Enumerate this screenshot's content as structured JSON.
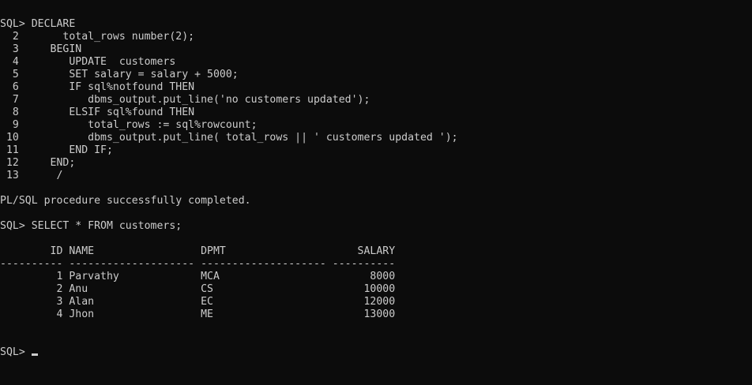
{
  "terminal": {
    "lines": [
      "SQL> DECLARE",
      "  2       total_rows number(2);",
      "  3     BEGIN",
      "  4        UPDATE  customers",
      "  5        SET salary = salary + 5000;",
      "  6        IF sql%notfound THEN",
      "  7           dbms_output.put_line('no customers updated');",
      "  8        ELSIF sql%found THEN",
      "  9           total_rows := sql%rowcount;",
      " 10           dbms_output.put_line( total_rows || ' customers updated ');",
      " 11        END IF;",
      " 12     END;",
      " 13      /",
      "",
      "PL/SQL procedure successfully completed.",
      "",
      "SQL> SELECT * FROM customers;",
      "",
      "        ID NAME                 DPMT                     SALARY",
      "---------- -------------------- -------------------- ----------",
      "         1 Parvathy             MCA                        8000",
      "         2 Anu                  CS                        10000",
      "         3 Alan                 EC                        12000",
      "         4 Jhon                 ME                        13000",
      "",
      ""
    ],
    "prompt": "SQL>"
  }
}
